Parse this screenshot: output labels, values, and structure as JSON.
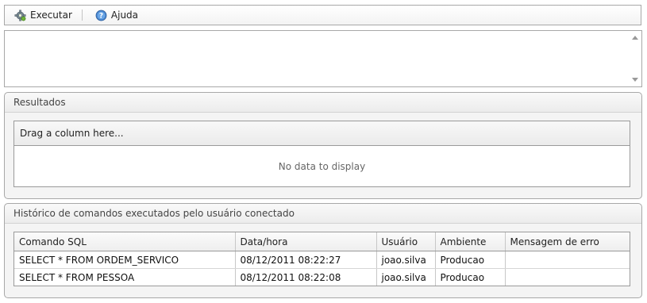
{
  "toolbar": {
    "execute_label": "Executar",
    "help_label": "Ajuda"
  },
  "editor": {
    "value": ""
  },
  "results": {
    "title": "Resultados",
    "group_hint": "Drag a column here...",
    "empty_text": "No data to display"
  },
  "history": {
    "title": "Histórico de comandos executados pelo usuário conectado",
    "columns": [
      "Comando SQL",
      "Data/hora",
      "Usuário",
      "Ambiente",
      "Mensagem de erro"
    ],
    "rows": [
      [
        "SELECT * FROM ORDEM_SERVICO",
        "08/12/2011 08:22:27",
        "joao.silva",
        "Producao",
        ""
      ],
      [
        "SELECT * FROM PESSOA",
        "08/12/2011 08:22:08",
        "joao.silva",
        "Producao",
        ""
      ]
    ]
  }
}
